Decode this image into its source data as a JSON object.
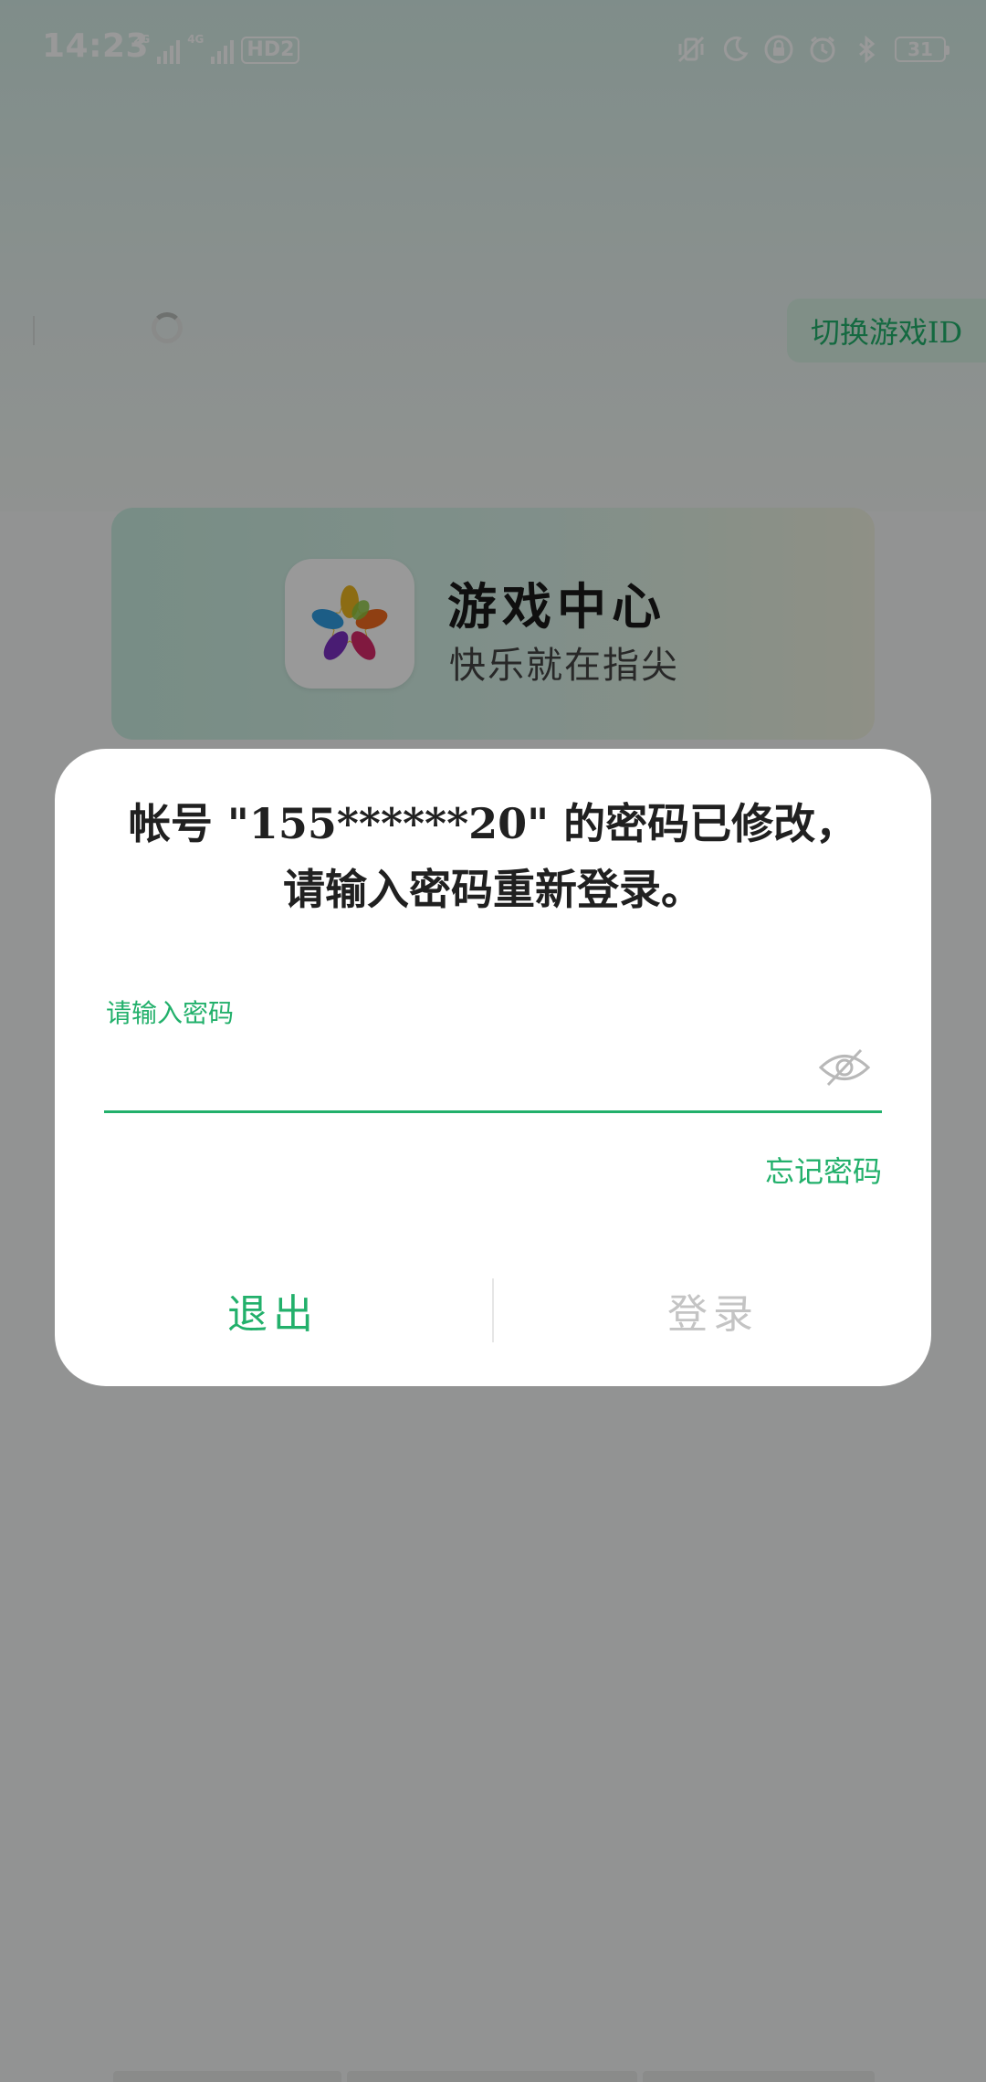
{
  "status_bar": {
    "time": "14:23",
    "net1_tag": "2G",
    "net2_tag": "4G",
    "hd_label": "HD2",
    "battery": "31",
    "icons": [
      "vibrate-icon",
      "moon-icon",
      "lock-rotation-icon",
      "alarm-icon",
      "bluetooth-icon",
      "battery-icon"
    ]
  },
  "header": {
    "switch_game_id": "切换游戏ID"
  },
  "banner": {
    "title": "游戏中心",
    "subtitle": "快乐就在指尖",
    "logo_icon": "star-logo-icon"
  },
  "dialog": {
    "message": "帐号 \"155******20\" 的密码已修改，请输入密码重新登录。",
    "password_label": "请输入密码",
    "password_value": "",
    "password_visibility_icon": "eye-off-icon",
    "forgot_password": "忘记密码",
    "exit_button": "退出",
    "login_button": "登录"
  },
  "colors": {
    "accent": "#22b06b",
    "disabled": "#c4c4c4",
    "overlay": "rgba(0,0,0,0.40)"
  }
}
